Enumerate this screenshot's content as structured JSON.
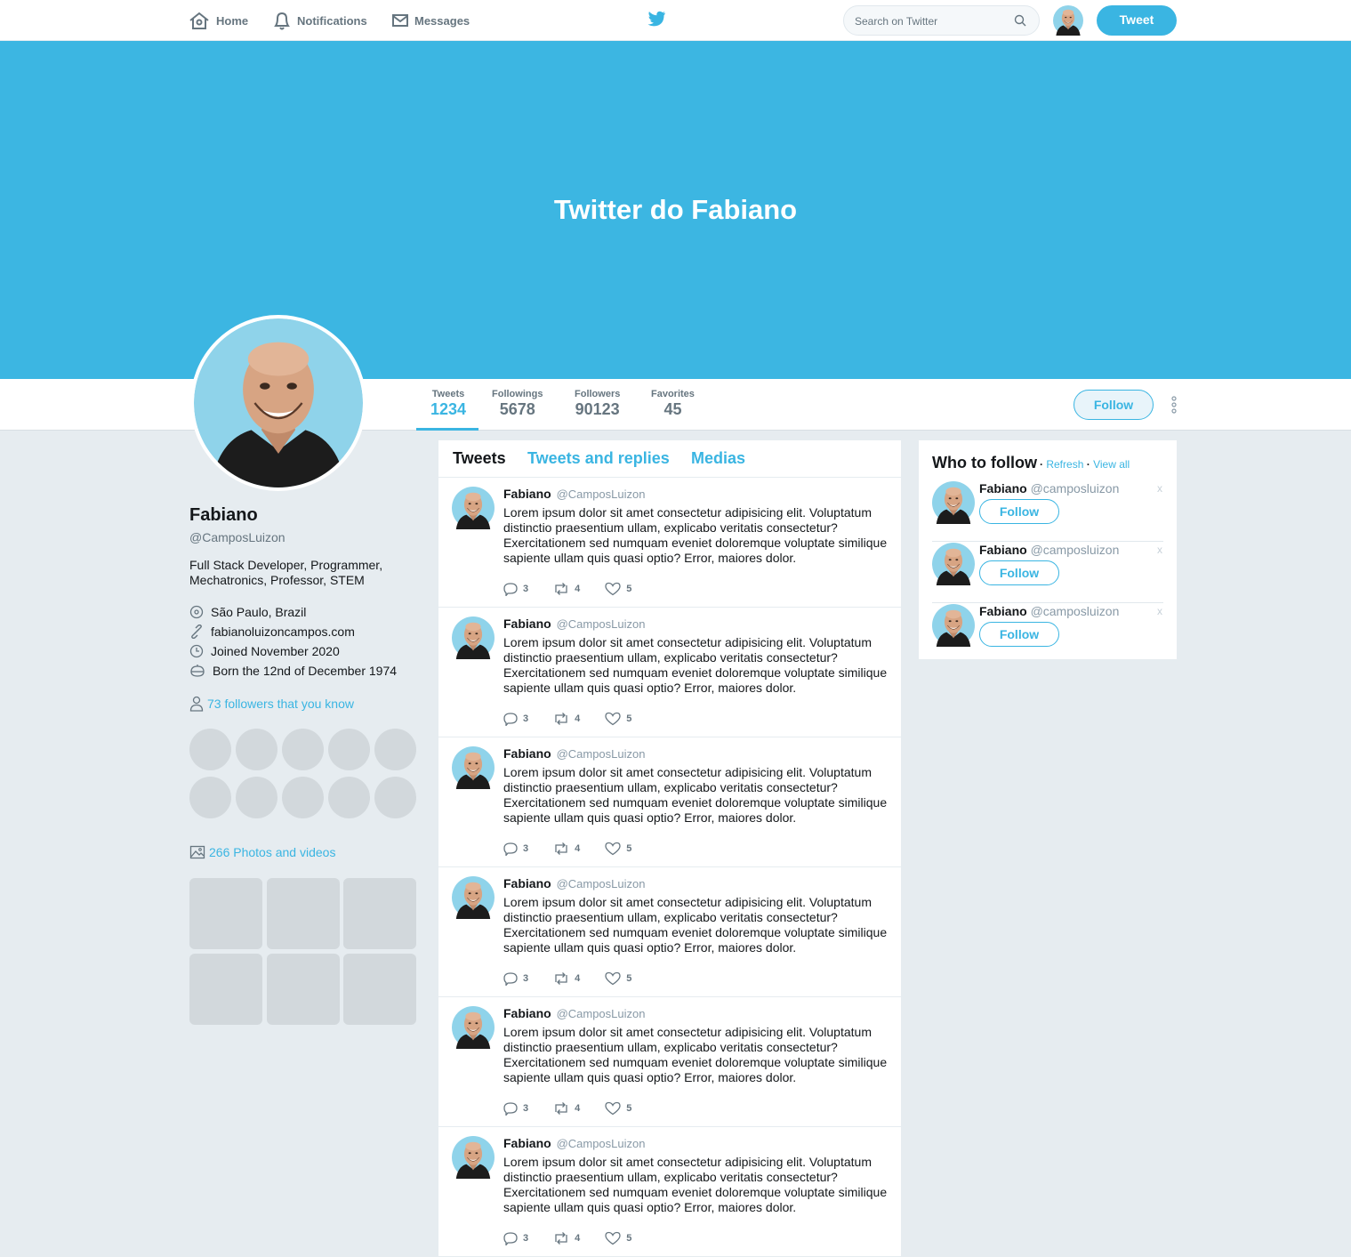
{
  "nav": {
    "home": "Home",
    "notifications": "Notifications",
    "messages": "Messages",
    "search_placeholder": "Search on Twitter",
    "tweet_button": "Tweet"
  },
  "banner": {
    "title": "Twitter do Fabiano"
  },
  "stats": [
    {
      "label": "Tweets",
      "value": "1234",
      "active": true
    },
    {
      "label": "Followings",
      "value": "5678"
    },
    {
      "label": "Followers",
      "value": "90123"
    },
    {
      "label": "Favorites",
      "value": "45"
    }
  ],
  "profile": {
    "follow_label": "Follow",
    "name": "Fabiano",
    "handle": "@CamposLuizon",
    "bio": "Full Stack Developer, Programmer, Mechatronics, Professor, STEM",
    "location": "São Paulo, Brazil",
    "website": "fabianoluizoncampos.com",
    "joined": "Joined November 2020",
    "born": "Born the 12nd of December 1974",
    "followers_you_know": "73 followers that you know",
    "photos_videos": "266 Photos and videos"
  },
  "timeline": {
    "tabs": [
      "Tweets",
      "Tweets and replies",
      "Medias"
    ],
    "tweets": [
      {
        "name": "Fabiano",
        "handle": "@CamposLuizon",
        "text": "Lorem ipsum dolor sit amet consectetur adipisicing elit. Voluptatum distinctio praesentium ullam, explicabo veritatis consectetur? Exercitationem sed numquam eveniet doloremque voluptate similique sapiente ullam quis quasi optio? Error, maiores dolor.",
        "replies": "3",
        "retweets": "4",
        "likes": "5"
      },
      {
        "name": "Fabiano",
        "handle": "@CamposLuizon",
        "text": "Lorem ipsum dolor sit amet consectetur adipisicing elit. Voluptatum distinctio praesentium ullam, explicabo veritatis consectetur? Exercitationem sed numquam eveniet doloremque voluptate similique sapiente ullam quis quasi optio? Error, maiores dolor.",
        "replies": "3",
        "retweets": "4",
        "likes": "5"
      },
      {
        "name": "Fabiano",
        "handle": "@CamposLuizon",
        "text": "Lorem ipsum dolor sit amet consectetur adipisicing elit. Voluptatum distinctio praesentium ullam, explicabo veritatis consectetur? Exercitationem sed numquam eveniet doloremque voluptate similique sapiente ullam quis quasi optio? Error, maiores dolor.",
        "replies": "3",
        "retweets": "4",
        "likes": "5"
      },
      {
        "name": "Fabiano",
        "handle": "@CamposLuizon",
        "text": "Lorem ipsum dolor sit amet consectetur adipisicing elit. Voluptatum distinctio praesentium ullam, explicabo veritatis consectetur? Exercitationem sed numquam eveniet doloremque voluptate similique sapiente ullam quis quasi optio? Error, maiores dolor.",
        "replies": "3",
        "retweets": "4",
        "likes": "5"
      },
      {
        "name": "Fabiano",
        "handle": "@CamposLuizon",
        "text": "Lorem ipsum dolor sit amet consectetur adipisicing elit. Voluptatum distinctio praesentium ullam, explicabo veritatis consectetur? Exercitationem sed numquam eveniet doloremque voluptate similique sapiente ullam quis quasi optio? Error, maiores dolor.",
        "replies": "3",
        "retweets": "4",
        "likes": "5"
      },
      {
        "name": "Fabiano",
        "handle": "@CamposLuizon",
        "text": "Lorem ipsum dolor sit amet consectetur adipisicing elit. Voluptatum distinctio praesentium ullam, explicabo veritatis consectetur? Exercitationem sed numquam eveniet doloremque voluptate similique sapiente ullam quis quasi optio? Error, maiores dolor.",
        "replies": "3",
        "retweets": "4",
        "likes": "5"
      }
    ]
  },
  "who_to_follow": {
    "title": "Who to follow",
    "refresh": "Refresh",
    "view_all": "View all",
    "suggestions": [
      {
        "name": "Fabiano",
        "handle": "@camposluizon",
        "follow": "Follow",
        "dismiss": "x"
      },
      {
        "name": "Fabiano",
        "handle": "@camposluizon",
        "follow": "Follow",
        "dismiss": "x"
      },
      {
        "name": "Fabiano",
        "handle": "@camposluizon",
        "follow": "Follow",
        "dismiss": "x"
      }
    ]
  },
  "colors": {
    "accent": "#3ab5e2",
    "banner": "#3cb6e2",
    "background": "#e6ecf0",
    "placeholder": "#d2d8dc"
  },
  "icons": [
    "home-icon",
    "bell-icon",
    "mail-icon",
    "twitter-bird-icon",
    "search-icon",
    "location-icon",
    "link-icon",
    "calendar-icon",
    "balloon-icon",
    "person-icon",
    "image-icon",
    "reply-icon",
    "retweet-icon",
    "heart-icon",
    "more-icon"
  ]
}
